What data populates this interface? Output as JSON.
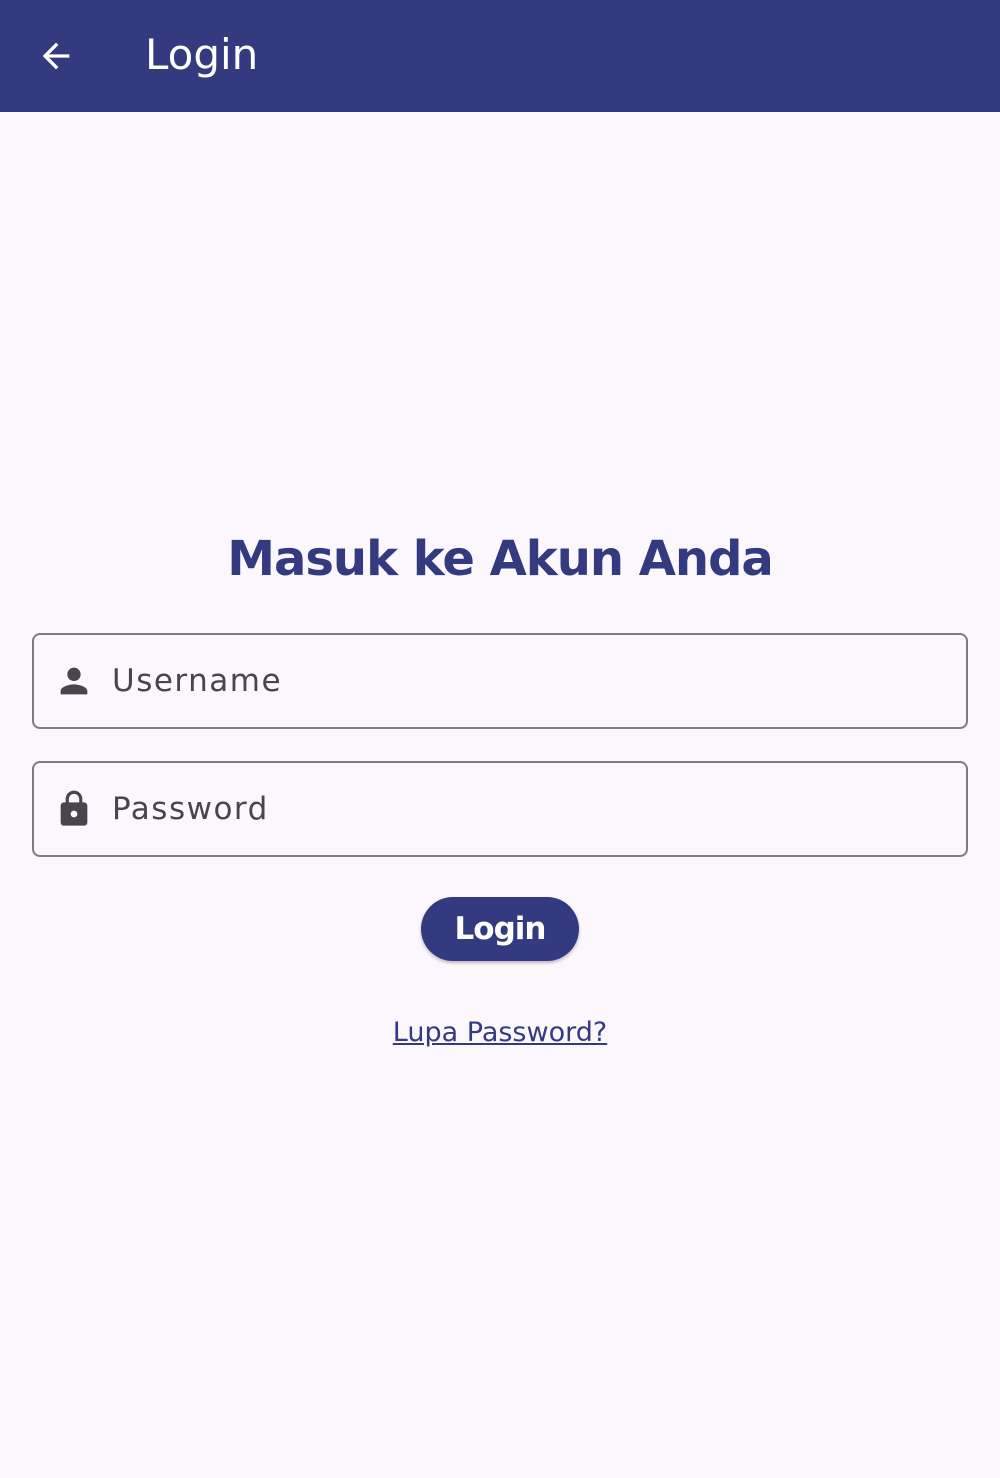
{
  "app_bar": {
    "title": "Login",
    "back_icon": "arrow-back-icon",
    "background_color": "#333a80"
  },
  "main": {
    "heading": "Masuk ke Akun Anda",
    "username_field": {
      "icon": "person-icon",
      "placeholder": "Username",
      "value": ""
    },
    "password_field": {
      "icon": "lock-icon",
      "placeholder": "Password",
      "value": ""
    },
    "login_button_label": "Login",
    "forgot_password_label": "Lupa Password?"
  },
  "colors": {
    "primary": "#333a80",
    "background": "#fcf7fc",
    "field_border": "#7d7a84",
    "field_text": "#48454e"
  }
}
